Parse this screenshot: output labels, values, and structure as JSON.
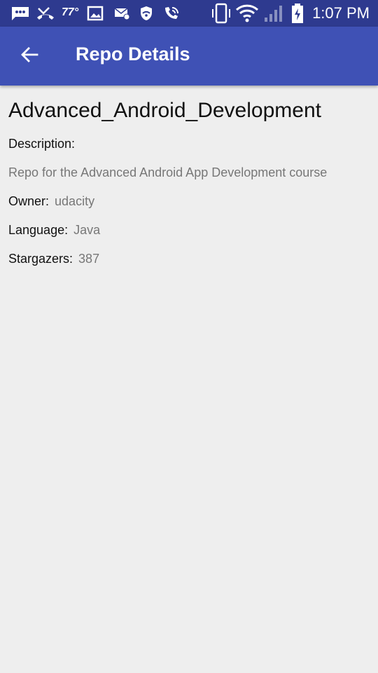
{
  "status_bar": {
    "temperature": "77°",
    "time": "1:07 PM",
    "icons": [
      "messaging-icon",
      "missed-call-icon",
      "weather-icon",
      "image-icon",
      "mail-icon",
      "vpn-shield-icon",
      "wifi-call-icon",
      "vibrate-icon",
      "wifi-icon",
      "signal-icon",
      "battery-charging-icon"
    ]
  },
  "app_bar": {
    "title": "Repo Details",
    "back_icon": "arrow-back-icon",
    "color": "#3f51b5"
  },
  "repo": {
    "name": "Advanced_Android_Development",
    "description_label": "Description:",
    "description": "Repo for the Advanced Android App Development course",
    "owner_label": "Owner:",
    "owner": "udacity",
    "language_label": "Language:",
    "language": "Java",
    "stargazers_label": "Stargazers:",
    "stargazers": "387"
  }
}
